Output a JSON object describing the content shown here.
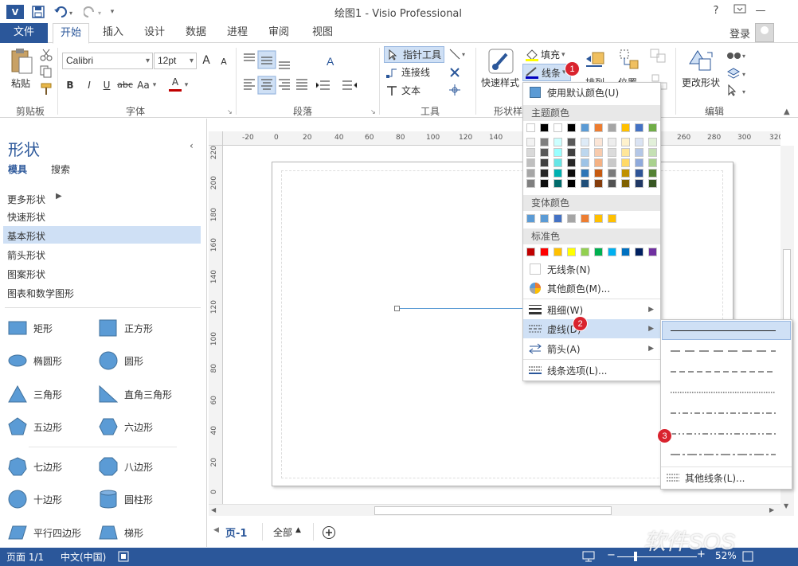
{
  "window": {
    "title": "绘图1 - Visio Professional",
    "help": "?",
    "controls": [
      "—",
      "☐",
      "✕"
    ]
  },
  "quick_access": {
    "app_icon": "V",
    "save_icon": "save-icon",
    "undo_icon": "undo-icon",
    "redo_icon": "redo-icon",
    "customize_icon": "customize-icon"
  },
  "tabs": {
    "file": "文件",
    "items": [
      "开始",
      "插入",
      "设计",
      "数据",
      "进程",
      "审阅",
      "视图"
    ],
    "active": "开始",
    "login": "登录"
  },
  "ribbon": {
    "clipboard": {
      "paste": "粘贴",
      "label": "剪贴板"
    },
    "font": {
      "family": "Calibri",
      "size": "12pt",
      "label": "字体",
      "bold": "B",
      "italic": "I",
      "underline": "U",
      "strike": "abc",
      "case": "Aa",
      "grow": "A",
      "shrink": "A",
      "color": "A"
    },
    "paragraph": {
      "label": "段落"
    },
    "tools": {
      "pointer": "指针工具",
      "connector": "连接线",
      "text": "文本",
      "label": "工具"
    },
    "shape_styles": {
      "quick": "快速样式",
      "fill": "填充",
      "line": "线条",
      "label": "形状样"
    },
    "arrange": {
      "arrange": "排列",
      "position": "位置"
    },
    "edit": {
      "change_shape": "更改形状",
      "label": "编辑"
    }
  },
  "pane": {
    "title": "形状",
    "tab_stencils": "模具",
    "tab_search": "搜索",
    "more": "更多形状",
    "links": [
      "快速形状",
      "基本形状",
      "箭头形状",
      "图案形状",
      "图表和数学图形"
    ],
    "selected": "基本形状",
    "shapes": [
      [
        "矩形",
        "正方形"
      ],
      [
        "椭圆形",
        "圆形"
      ],
      [
        "三角形",
        "直角三角形"
      ],
      [
        "五边形",
        "六边形"
      ],
      [
        "七边形",
        "八边形"
      ],
      [
        "十边形",
        "圆柱形"
      ],
      [
        "平行四边形",
        "梯形"
      ]
    ]
  },
  "ruler": {
    "h": [
      "-20",
      "0",
      "20",
      "40",
      "60",
      "80",
      "100",
      "120",
      "140",
      "260",
      "280",
      "300",
      "320"
    ],
    "v": [
      "220",
      "200",
      "180",
      "160",
      "140",
      "120",
      "100",
      "80",
      "60",
      "40",
      "20",
      "0"
    ]
  },
  "menu": {
    "default_color": "使用默认颜色(U)",
    "theme_header": "主题颜色",
    "variant_header": "变体颜色",
    "standard_header": "标准色",
    "no_line": "无线条(N)",
    "more_colors": "其他颜色(M)...",
    "weight": "粗细(W)",
    "dashes": "虚线(D)",
    "arrows": "箭头(A)",
    "line_options": "线条选项(L)...",
    "theme_top": [
      "#ffffff",
      "#000000",
      "#ffffff",
      "#000000",
      "#5b9bd5",
      "#ed7d31",
      "#a5a5a5",
      "#ffc000",
      "#4472c4",
      "#70ad47"
    ],
    "theme_cols": [
      [
        "#f2f2f2",
        "#d9d9d9",
        "#bfbfbf",
        "#a6a6a6",
        "#7f7f7f"
      ],
      [
        "#7f7f7f",
        "#595959",
        "#404040",
        "#262626",
        "#0d0d0d"
      ],
      [
        "#ccffff",
        "#99ffff",
        "#66e6e6",
        "#00b0b0",
        "#006b6b"
      ],
      [
        "#595959",
        "#404040",
        "#262626",
        "#0d0d0d",
        "#000000"
      ],
      [
        "#deebf7",
        "#bdd7ee",
        "#9dc3e6",
        "#2e75b6",
        "#1f4e79"
      ],
      [
        "#fbe5d6",
        "#f8cbad",
        "#f4b183",
        "#c55a11",
        "#843c0c"
      ],
      [
        "#ededed",
        "#dbdbdb",
        "#c9c9c9",
        "#7b7b7b",
        "#525252"
      ],
      [
        "#fff2cc",
        "#ffe699",
        "#ffd966",
        "#bf9000",
        "#7f6000"
      ],
      [
        "#dae3f3",
        "#b4c7e7",
        "#8faadc",
        "#2f5597",
        "#203864"
      ],
      [
        "#e2f0d9",
        "#c5e0b4",
        "#a9d18e",
        "#548235",
        "#385723"
      ]
    ],
    "variant": [
      "#5b9bd5",
      "#5b9bd5",
      "#4472c4",
      "#a5a5a5",
      "#ed7d31",
      "#ffc000",
      "#ffc000"
    ],
    "standard": [
      "#c00000",
      "#ff0000",
      "#ffc000",
      "#ffff00",
      "#92d050",
      "#00b050",
      "#00b0f0",
      "#0070c0",
      "#002060",
      "#7030a0"
    ]
  },
  "submenu": {
    "more_dashes": "其他线条(L)..."
  },
  "badges": [
    "1",
    "2",
    "3"
  ],
  "pages": {
    "current": "页-1",
    "all": "全部"
  },
  "status": {
    "page": "页面 1/1",
    "lang": "中文(中国)",
    "zoom": "52%"
  },
  "watermark": "软件SOS"
}
